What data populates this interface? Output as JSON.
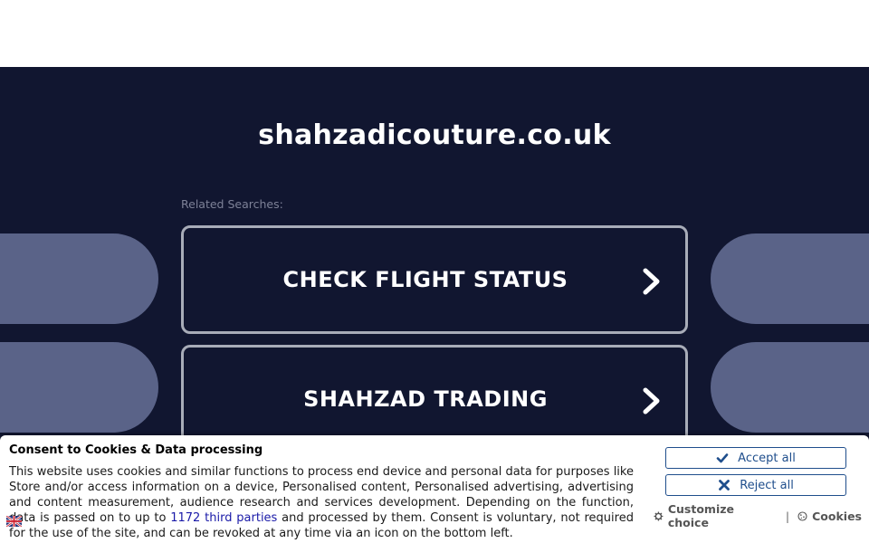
{
  "site": {
    "domain": "shahzadicouture.co.uk",
    "related_label": "Related Searches:"
  },
  "searches": [
    {
      "label": "CHECK FLIGHT STATUS"
    },
    {
      "label": "SHAHZAD TRADING"
    }
  ],
  "consent": {
    "title": "Consent to Cookies & Data processing",
    "text_before_link": "This website uses cookies and similar functions to process end device and personal data for purposes like Store and/or access information on a device, Personalised content, Personalised advertising, advertising and content measurement, audience research and services development. Depending on the function, data is passed on to up to ",
    "link_text": "1172 third parties",
    "text_after_link": " and processed by them. Consent is voluntary, not required for the use of the site, and can be revoked at any time via an icon on the bottom left.",
    "accept_label": "Accept all",
    "reject_label": "Reject all",
    "customize_label": "Customize choice",
    "separator": "|",
    "cookies_label": "Cookies"
  },
  "icons": {
    "chevron": "chevron-right-icon",
    "accept": "check-icon",
    "reject": "x-icon",
    "customize": "gear-icon",
    "cookies": "cookie-icon",
    "language": "uk-flag-icon"
  },
  "colors": {
    "background": "#111630",
    "pill": "#5a6388",
    "button_border": "#a8acb8",
    "consent_accent": "#1f4e8c"
  }
}
